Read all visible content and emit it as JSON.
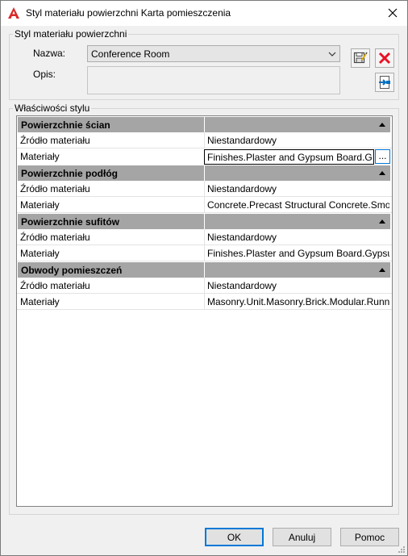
{
  "window": {
    "title": "Styl materiału powierzchni Karta pomieszczenia"
  },
  "surface_group": {
    "label": "Styl materiału powierzchni",
    "name_label": "Nazwa:",
    "name_value": "Conference Room",
    "desc_label": "Opis:",
    "desc_value": ""
  },
  "properties_group": {
    "label": "Właściwości stylu",
    "categories": [
      {
        "label": "Powierzchnie ścian",
        "rows": [
          {
            "name": "Źródło materiału",
            "value": "Niestandardowy"
          },
          {
            "name": "Materiały",
            "value": "Finishes.Plaster and Gypsum Board.Gypsum"
          }
        ]
      },
      {
        "label": "Powierzchnie podłóg",
        "rows": [
          {
            "name": "Źródło materiału",
            "value": "Niestandardowy"
          },
          {
            "name": "Materiały",
            "value": "Concrete.Precast Structural Concrete.Smooth"
          }
        ]
      },
      {
        "label": "Powierzchnie sufitów",
        "rows": [
          {
            "name": "Źródło materiału",
            "value": "Niestandardowy"
          },
          {
            "name": "Materiały",
            "value": "Finishes.Plaster and Gypsum Board.Gypsum"
          }
        ]
      },
      {
        "label": "Obwody pomieszczeń",
        "rows": [
          {
            "name": "Źródło materiału",
            "value": "Niestandardowy"
          },
          {
            "name": "Materiały",
            "value": "Masonry.Unit.Masonry.Brick.Modular.Running"
          }
        ]
      }
    ],
    "ellipsis_label": "..."
  },
  "buttons": {
    "ok": "OK",
    "cancel": "Anuluj",
    "help": "Pomoc"
  },
  "colors": {
    "category_header": "#a5a5a5",
    "accent": "#0078d7",
    "delete_red": "#e81123",
    "app_icon_red": "#d82a2a"
  }
}
